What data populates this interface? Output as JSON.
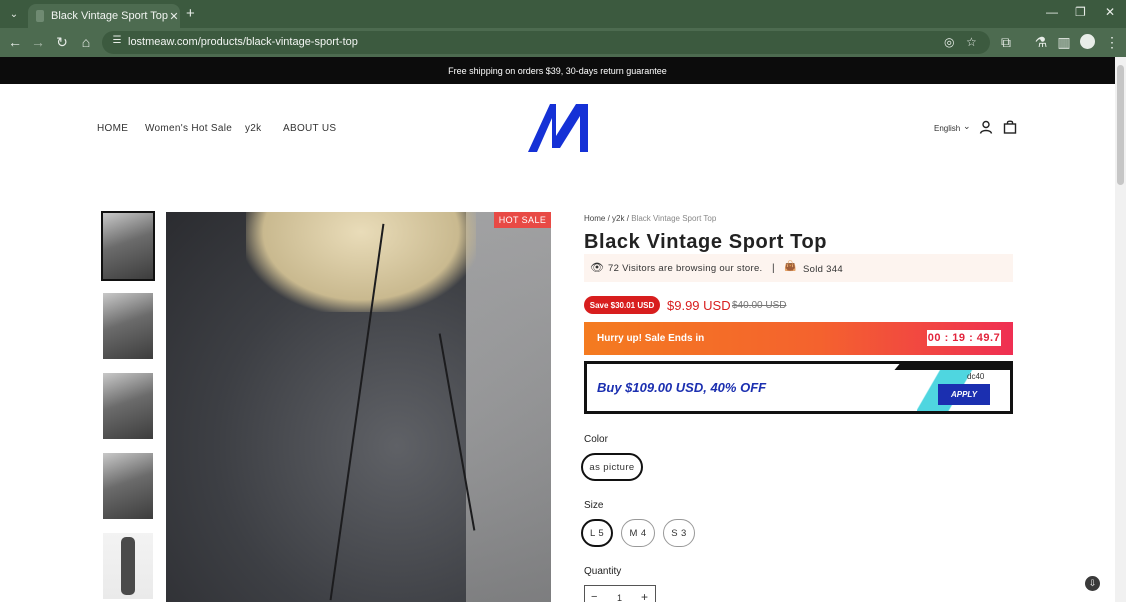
{
  "browser": {
    "tab_title": "Black Vintage Sport Top",
    "url": "lostmeaw.com/products/black-vintage-sport-top"
  },
  "announcement": "Free shipping on orders $39, 30-days return guarantee",
  "nav": {
    "items": [
      "HOME",
      "Women's Hot Sale",
      "y2k",
      "ABOUT US"
    ],
    "language": "English",
    "logo_color": "#1531d6"
  },
  "gallery": {
    "badge": "HOT SALE",
    "badge_color": "#e84a45"
  },
  "product": {
    "breadcrumb": {
      "home": "Home",
      "sep": "/",
      "collection": "y2k",
      "current": "Black Vintage Sport Top"
    },
    "title": "Black Vintage Sport Top",
    "visitors_text": "72 Visitors are browsing our store.",
    "divider": "|",
    "sold_text": "Sold 344",
    "save_badge": "Save $30.01 USD",
    "price": "$9.99 USD",
    "compare_price": "$40.00 USD",
    "price_color": "#d81e1e",
    "countdown_label": "Hurry up! Sale Ends in",
    "countdown_time": "00 : 19 : 49.7",
    "coupon_text": "Buy $109.00 USD, 40% OFF",
    "coupon_code": "dc40",
    "coupon_apply": "APPLY",
    "color_label": "Color",
    "color_options": [
      "as picture"
    ],
    "size_label": "Size",
    "size_options": [
      "L 5",
      "M 4",
      "S 3"
    ],
    "quantity_label": "Quantity",
    "quantity_value": "1",
    "qty_minus": "−",
    "qty_plus": "+"
  }
}
